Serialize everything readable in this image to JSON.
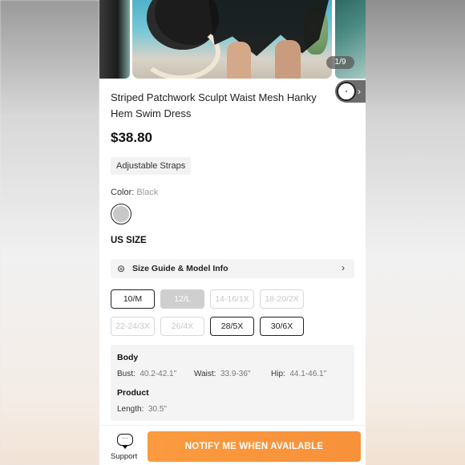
{
  "gallery": {
    "pager": "1/9"
  },
  "product": {
    "title": "Striped Patchwork Sculpt Waist Mesh Hanky Hem Swim Dress",
    "price": "$38.80",
    "tag": "Adjustable Straps",
    "color_label": "Color",
    "color_value": "Black",
    "swatch_color": "#c8c8c8"
  },
  "size": {
    "heading": "US SIZE",
    "guide_label": "Size Guide & Model Info",
    "options": [
      {
        "label": "10/M",
        "state": "available"
      },
      {
        "label": "12/L",
        "state": "selected"
      },
      {
        "label": "14-16/1X",
        "state": "disabled"
      },
      {
        "label": "18-20/2X",
        "state": "disabled"
      },
      {
        "label": "22-24/3X",
        "state": "disabled"
      },
      {
        "label": "26/4X",
        "state": "disabled"
      },
      {
        "label": "28/5X",
        "state": "available"
      },
      {
        "label": "30/6X",
        "state": "available"
      }
    ]
  },
  "measurements": {
    "body_heading": "Body",
    "bust_label": "Bust:",
    "bust_value": "40.2-42.1\"",
    "waist_label": "Waist:",
    "waist_value": "33.9-36\"",
    "hip_label": "Hip:",
    "hip_value": "44.1-46.1\"",
    "product_heading": "Product",
    "length_label": "Length:",
    "length_value": "30.5\""
  },
  "bottom": {
    "support_label": "Support",
    "support_icon": "chat-bubble-icon",
    "notify_label": "NOTIFY ME WHEN AVAILABLE",
    "notify_color": "#f7913a"
  }
}
